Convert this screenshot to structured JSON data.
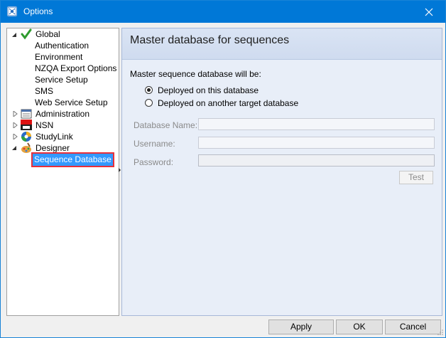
{
  "window": {
    "title": "Options",
    "app_icon": "options-icon",
    "close_icon": "close-icon"
  },
  "tree": {
    "items": [
      {
        "label": "Global",
        "icon": "checkmark-icon"
      },
      {
        "label": "Authentication"
      },
      {
        "label": "Environment"
      },
      {
        "label": "NZQA Export Options"
      },
      {
        "label": "Service Setup"
      },
      {
        "label": "SMS"
      },
      {
        "label": "Web Service Setup"
      },
      {
        "label": "Administration",
        "icon": "administration-icon"
      },
      {
        "label": "NSN",
        "icon": "nsn-icon"
      },
      {
        "label": "StudyLink",
        "icon": "studylink-icon"
      },
      {
        "label": "Designer",
        "icon": "designer-icon"
      },
      {
        "label": "Sequence Database",
        "selected": true
      }
    ]
  },
  "panel": {
    "title": "Master database for sequences",
    "prompt": "Master sequence database will be:",
    "options": [
      {
        "label": "Deployed on this database",
        "checked": true
      },
      {
        "label": "Deployed on another target database",
        "checked": false
      }
    ],
    "fields": {
      "db_name_label": "Database Name:",
      "username_label": "Username:",
      "password_label": "Password:",
      "db_name_value": "",
      "username_value": "",
      "password_value": ""
    },
    "test_label": "Test"
  },
  "buttons": {
    "apply": "Apply",
    "ok": "OK",
    "cancel": "Cancel"
  },
  "colors": {
    "titlebar": "#0078d7",
    "selection": "#3399ff",
    "highlight_box": "#e8303a",
    "panel_bg": "#e8eef8"
  }
}
